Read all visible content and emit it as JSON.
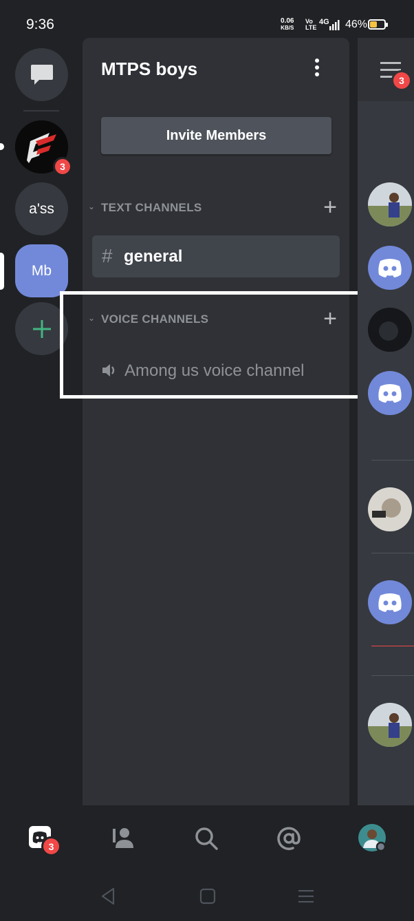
{
  "status_bar": {
    "time": "9:36",
    "net_speed": "0.06",
    "net_unit": "KB/S",
    "volte_top": "Vo",
    "volte_bottom": "LTE",
    "signal": "4G",
    "battery": "46%"
  },
  "server_rail": {
    "dm_icon": "chat-bubble-icon",
    "servers": [
      {
        "name": "F",
        "badge": "3"
      },
      {
        "name": "a'ss"
      },
      {
        "name": "Mb",
        "selected": true
      }
    ],
    "add_icon": "plus-icon"
  },
  "channel_panel": {
    "guild_name": "MTPS boys",
    "invite_label": "Invite Members",
    "text_category": "TEXT CHANNELS",
    "text_channels": [
      {
        "name": "general",
        "icon": "hash-icon"
      }
    ],
    "voice_category": "VOICE CHANNELS",
    "voice_channels": [
      {
        "name": "Among us voice channel",
        "icon": "speaker-icon"
      }
    ]
  },
  "members_panel": {
    "badge": "3"
  },
  "bottom_nav": {
    "home_badge": "3"
  },
  "colors": {
    "background": "#202225",
    "panel": "#2f3136",
    "accent": "#7289da",
    "danger": "#f04747",
    "online": "#43b581"
  }
}
